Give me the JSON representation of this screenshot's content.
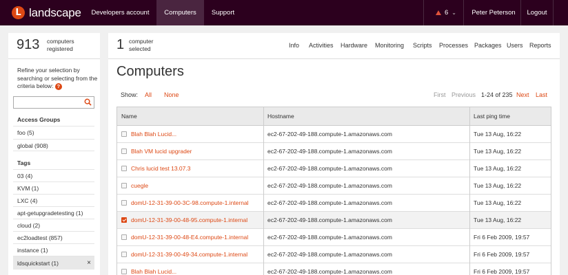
{
  "topbar": {
    "logo_letter": "L",
    "app_name": "landscape",
    "nav": [
      "Developers account",
      "Computers",
      "Support"
    ],
    "active_nav": "Computers",
    "alert_count": "6",
    "user": "Peter Peterson",
    "logout": "Logout"
  },
  "sidebar": {
    "count": "913",
    "count_label_1": "computers",
    "count_label_2": "registered",
    "refine_text": "Refine your selection by searching or selecting from the criteria below:",
    "help_glyph": "?",
    "search_value": "",
    "access_groups_heading": "Access Groups",
    "access_groups": [
      "foo (5)",
      "global (908)"
    ],
    "tags_heading": "Tags",
    "tags": [
      "03 (4)",
      "KVM (1)",
      "LXC (4)",
      "apt-getupgradetesting (1)",
      "cloud (2)",
      "ec2loadtest (857)",
      "instance (1)",
      "ldsquickstart (1)"
    ],
    "selected_tag": "ldsquickstart (1)",
    "remove_glyph": "×"
  },
  "main": {
    "selected_count": "1",
    "selected_label_1": "computer",
    "selected_label_2": "selected",
    "tabs": [
      "Info",
      "Activities",
      "Hardware",
      "Monitoring",
      "Scripts",
      "Processes",
      "Packages",
      "Users",
      "Reports"
    ],
    "title": "Computers",
    "show_label": "Show:",
    "show_all": "All",
    "show_none": "None",
    "pager": {
      "first": "First",
      "previous": "Previous",
      "range": "1-24 of 235",
      "next": "Next",
      "last": "Last"
    },
    "columns": [
      "Name",
      "Hostname",
      "Last ping time"
    ],
    "rows": [
      {
        "name": "Blah Blah Lucid...",
        "hostname": "ec2-67-202-49-188.compute-1.amazonaws.com",
        "ping": "Tue 13 Aug, 16:22",
        "checked": false
      },
      {
        "name": "Blah VM lucid upgrader",
        "hostname": "ec2-67-202-49-188.compute-1.amazonaws.com",
        "ping": "Tue 13 Aug, 16:22",
        "checked": false
      },
      {
        "name": "Chris lucid test 13.07.3",
        "hostname": "ec2-67-202-49-188.compute-1.amazonaws.com",
        "ping": "Tue 13 Aug, 16:22",
        "checked": false
      },
      {
        "name": "cuegle",
        "hostname": "ec2-67-202-49-188.compute-1.amazonaws.com",
        "ping": "Tue 13 Aug, 16:22",
        "checked": false
      },
      {
        "name": "domU-12-31-39-00-3C-98.compute-1.internal",
        "hostname": "ec2-67-202-49-188.compute-1.amazonaws.com",
        "ping": "Tue 13 Aug, 16:22",
        "checked": false
      },
      {
        "name": "domU-12-31-39-00-48-95.compute-1.internal",
        "hostname": "ec2-67-202-49-188.compute-1.amazonaws.com",
        "ping": "Tue 13 Aug, 16:22",
        "checked": true
      },
      {
        "name": "domU-12-31-39-00-48-E4.compute-1.internal",
        "hostname": "ec2-67-202-49-188.compute-1.amazonaws.com",
        "ping": "Fri 6 Feb 2009, 19:57",
        "checked": false
      },
      {
        "name": "domU-12-31-39-00-49-34.compute-1.internal",
        "hostname": "ec2-67-202-49-188.compute-1.amazonaws.com",
        "ping": "Fri 6 Feb 2009, 19:57",
        "checked": false
      },
      {
        "name": "Blah Blah Lucid...",
        "hostname": "ec2-67-202-49-188.compute-1.amazonaws.com",
        "ping": "Fri 6 Feb 2009, 19:57",
        "checked": false
      }
    ]
  },
  "colors": {
    "brand": "#dd4814",
    "topbar": "#2c001e",
    "active_nav": "#4a2540",
    "alert": "#e0533b"
  }
}
